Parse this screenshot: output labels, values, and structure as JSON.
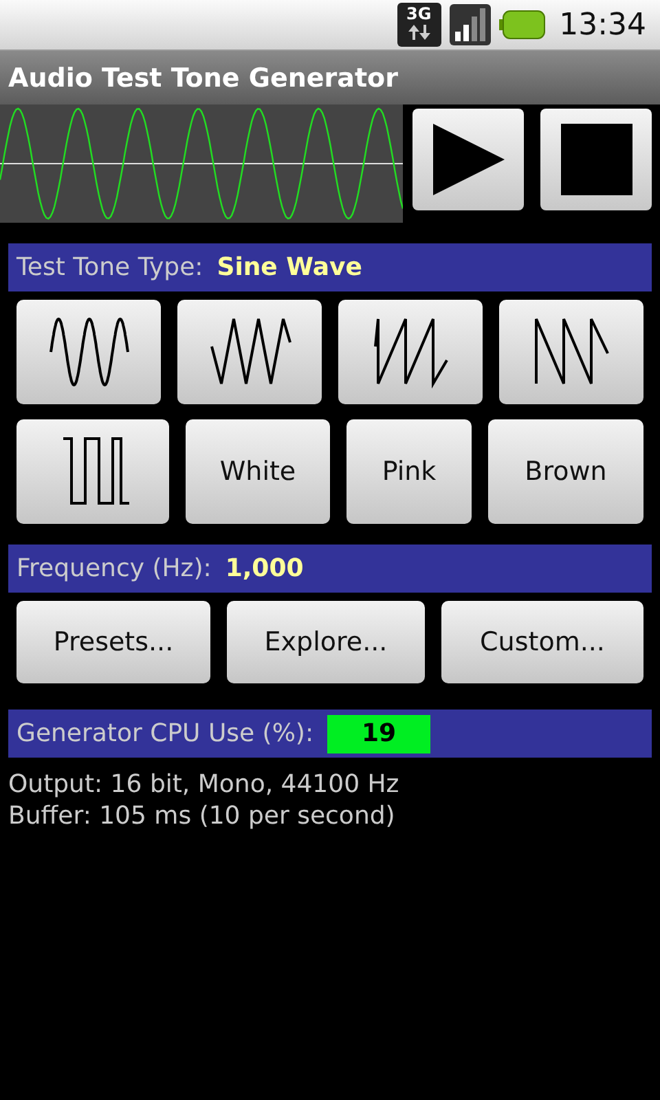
{
  "status_bar": {
    "network": "3G",
    "time": "13:34"
  },
  "window": {
    "title": "Audio Test Tone Generator"
  },
  "tone_type": {
    "label": "Test Tone Type:",
    "value": "Sine Wave"
  },
  "tone_buttons": [
    {
      "kind": "sine"
    },
    {
      "kind": "triangle"
    },
    {
      "kind": "saw"
    },
    {
      "kind": "reverse_saw"
    },
    {
      "kind": "square"
    },
    {
      "kind": "text",
      "label": "White"
    },
    {
      "kind": "text",
      "label": "Pink"
    },
    {
      "kind": "text",
      "label": "Brown"
    }
  ],
  "frequency": {
    "label": "Frequency (Hz):",
    "value": "1,000"
  },
  "frequency_buttons": [
    "Presets...",
    "Explore...",
    "Custom..."
  ],
  "cpu": {
    "label": "Generator CPU Use (%):",
    "value": "19"
  },
  "info_lines": [
    "Output: 16 bit, Mono, 44100 Hz",
    "Buffer: 105 ms (10 per second)"
  ]
}
